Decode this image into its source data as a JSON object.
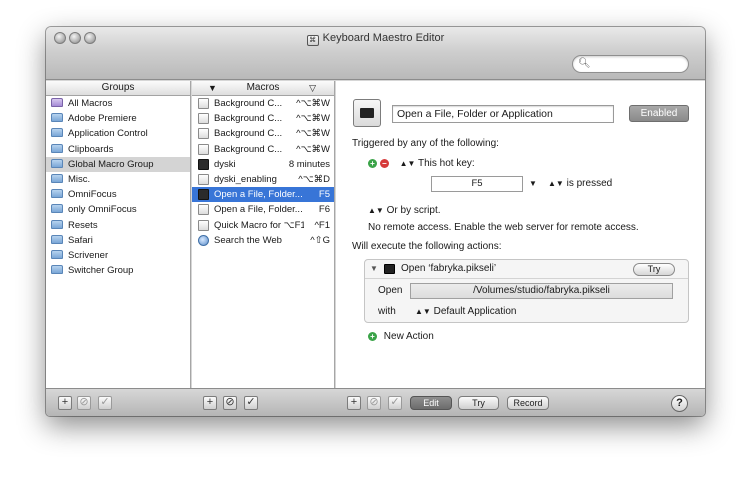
{
  "window": {
    "title": "Keyboard Maestro Editor"
  },
  "search": {
    "placeholder": ""
  },
  "groups": {
    "header": "Groups",
    "items": [
      {
        "label": "All Macros",
        "icon": "purple-folder-icon"
      },
      {
        "label": "Adobe Premiere",
        "icon": "folder-icon"
      },
      {
        "label": "Application Control",
        "icon": "folder-icon"
      },
      {
        "label": "Clipboards",
        "icon": "folder-icon"
      },
      {
        "label": "Global Macro Group",
        "icon": "folder-icon",
        "selected": true
      },
      {
        "label": "Misc.",
        "icon": "folder-icon"
      },
      {
        "label": "OmniFocus",
        "icon": "folder-icon"
      },
      {
        "label": "only OmniFocus",
        "icon": "folder-icon"
      },
      {
        "label": "Resets",
        "icon": "folder-icon"
      },
      {
        "label": "Safari",
        "icon": "folder-icon"
      },
      {
        "label": "Scrivener",
        "icon": "folder-icon"
      },
      {
        "label": "Switcher Group",
        "icon": "folder-icon"
      }
    ]
  },
  "macros": {
    "header": "Macros",
    "items": [
      {
        "name": "Background C...",
        "key": "^⌥⌘W",
        "icon": "script-icon"
      },
      {
        "name": "Background C...",
        "key": "^⌥⌘W",
        "icon": "script-icon"
      },
      {
        "name": "Background C...",
        "key": "^⌥⌘W",
        "icon": "script-icon"
      },
      {
        "name": "Background C...",
        "key": "^⌥⌘W",
        "icon": "script-icon"
      },
      {
        "name": "dyski",
        "key": "8 minutes",
        "icon": "disk-icon"
      },
      {
        "name": "dyski_enabling",
        "key": "^⌥⌘D",
        "icon": "script-icon"
      },
      {
        "name": "Open a File, Folder...",
        "key": "F5",
        "icon": "open-file-icon",
        "selected": true
      },
      {
        "name": "Open a File, Folder...",
        "key": "F6",
        "icon": "folder-icon"
      },
      {
        "name": "Quick Macro for ⌥F1",
        "key": "^F1",
        "icon": "quick-macro-icon"
      },
      {
        "name": "Search the Web",
        "key": "^⇧G",
        "icon": "globe-icon"
      }
    ]
  },
  "editor": {
    "macro_name": "Open a File, Folder or Application",
    "enabled_label": "Enabled",
    "triggered_label": "Triggered by any of the following:",
    "hotkey_label": "This hot key:",
    "hotkey_value": "F5",
    "pressed_label": "is pressed",
    "script_label": "Or by script.",
    "remote_text": "No remote access.  Enable the web server for remote access.",
    "execute_label": "Will execute the following actions:",
    "action": {
      "title": "Open ‘fabryka.pikseli’",
      "try_label": "Try",
      "open_label": "Open",
      "path": "/Volumes/studio/fabryka.pikseli",
      "with_label": "with",
      "app_value": "Default Application"
    },
    "new_action_label": "New Action"
  },
  "toolbar": {
    "edit_label": "Edit",
    "try_label": "Try",
    "record_label": "Record",
    "help_label": "?"
  },
  "colors": {
    "selection": "#3875d7",
    "enabled_bg": "#9a9a9a"
  }
}
